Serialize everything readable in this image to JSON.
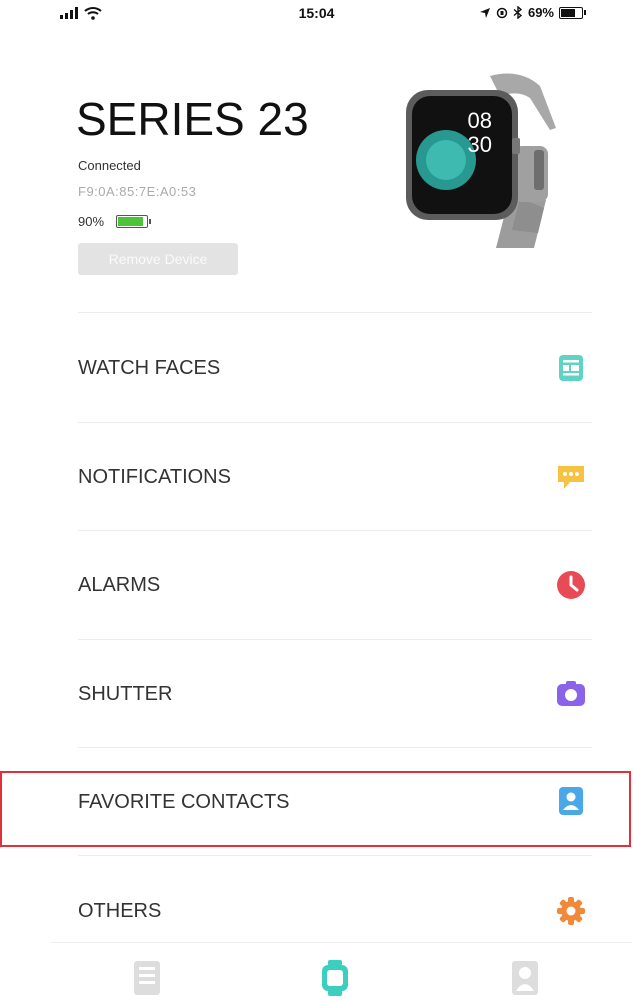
{
  "status_bar": {
    "time": "15:04",
    "battery_percent": "69%",
    "battery_level": 0.69
  },
  "device": {
    "name": "SERIES 23",
    "connection_status": "Connected",
    "mac_address": "F9:0A:85:7E:A0:53",
    "battery_percent": "90%",
    "battery_level": 0.9,
    "remove_label": "Remove Device",
    "watch_display_hour": "08",
    "watch_display_minute": "30"
  },
  "menu": {
    "items": [
      {
        "label": "WATCH FACES",
        "icon": "watch-faces-icon",
        "color": "#5fd4c4"
      },
      {
        "label": "NOTIFICATIONS",
        "icon": "message-icon",
        "color": "#f5c242"
      },
      {
        "label": "ALARMS",
        "icon": "clock-icon",
        "color": "#e84b55"
      },
      {
        "label": "SHUTTER",
        "icon": "camera-icon",
        "color": "#8a63e8"
      },
      {
        "label": "FAVORITE CONTACTS",
        "icon": "contact-card-icon",
        "color": "#4aa8e8"
      },
      {
        "label": "OTHERS",
        "icon": "gear-icon",
        "color": "#f08a3a"
      }
    ]
  },
  "highlighted_item": "FAVORITE CONTACTS",
  "colors": {
    "highlight_border": "#e0303c",
    "nav_active": "#3ccfbf",
    "nav_inactive": "#dddddd",
    "battery_green": "#4cc437"
  },
  "bottom_nav": {
    "items": [
      {
        "icon": "list-icon",
        "active": false
      },
      {
        "icon": "watch-icon",
        "active": true
      },
      {
        "icon": "profile-icon",
        "active": false
      }
    ]
  }
}
